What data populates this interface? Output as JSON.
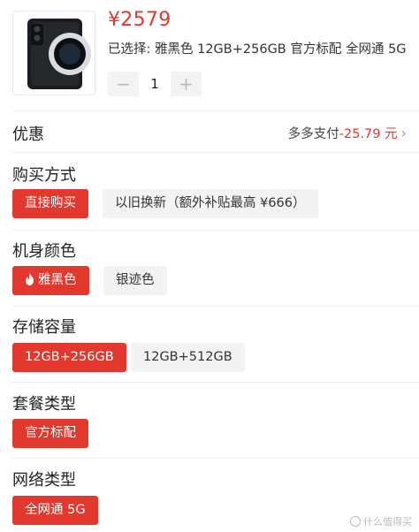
{
  "product": {
    "price": "¥2579",
    "selected_text": "已选择: 雅黑色 12GB+256GB 官方标配 全网通 5G",
    "quantity": "1",
    "minus_label": "−",
    "plus_label": "+"
  },
  "discount": {
    "title": "优惠",
    "provider": "多多支付",
    "amount": "-25.79 元"
  },
  "sections": {
    "purchase": {
      "title": "购买方式",
      "options": [
        "直接购买",
        "以旧换新（额外补贴最高 ¥666）"
      ],
      "selected": 0
    },
    "color": {
      "title": "机身颜色",
      "options": [
        "雅黑色",
        "银迹色"
      ],
      "selected": 0
    },
    "storage": {
      "title": "存储容量",
      "options": [
        "12GB+256GB",
        "12GB+512GB"
      ],
      "selected": 0
    },
    "package": {
      "title": "套餐类型",
      "options": [
        "官方标配"
      ],
      "selected": 0
    },
    "network": {
      "title": "网络类型",
      "options": [
        "全网通 5G"
      ],
      "selected": 0
    }
  },
  "colors": {
    "accent": "#e2382e",
    "chip_bg": "#f3f3f3"
  },
  "watermark": "什么值得买"
}
